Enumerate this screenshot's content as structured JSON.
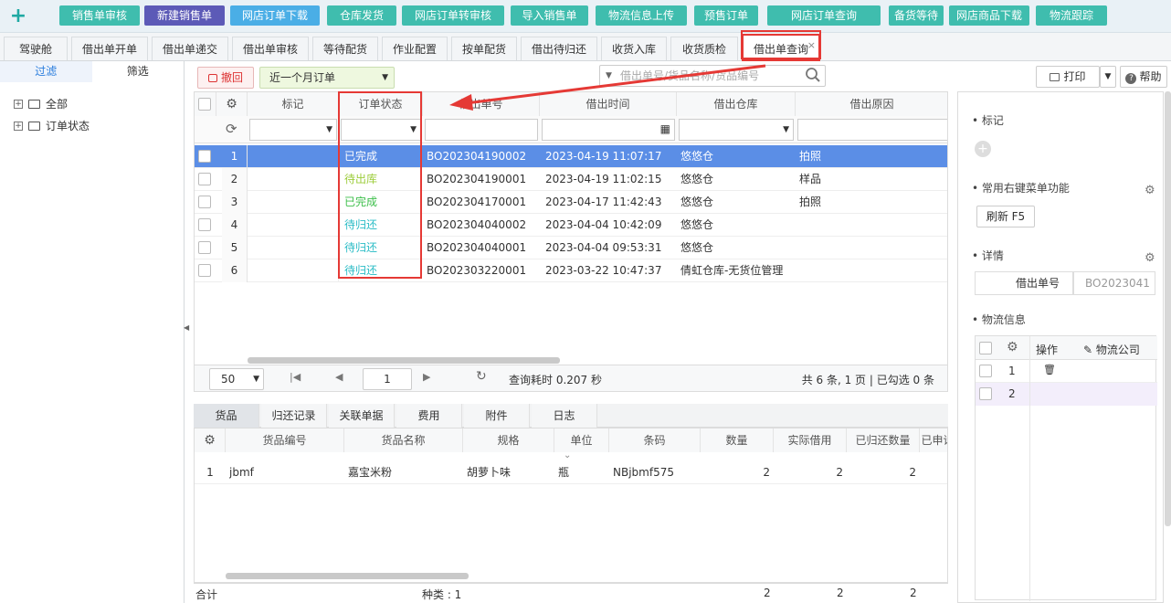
{
  "top_buttons": [
    {
      "label": "销售单审核",
      "color": "#3fbdae"
    },
    {
      "label": "新建销售单",
      "color": "#5c5ab7"
    },
    {
      "label": "网店订单下载",
      "color": "#4aaee6"
    },
    {
      "label": "仓库发货",
      "color": "#3fbdae"
    },
    {
      "label": "网店订单转审核",
      "color": "#3fbdae"
    },
    {
      "label": "导入销售单",
      "color": "#3fbdae"
    },
    {
      "label": "物流信息上传",
      "color": "#3fbdae"
    },
    {
      "label": "预售订单",
      "color": "#3fbdae"
    },
    {
      "label": "网店订单查询",
      "color": "#3fbdae"
    },
    {
      "label": "备货等待",
      "color": "#3fbdae"
    },
    {
      "label": "网店商品下载",
      "color": "#3fbdae"
    },
    {
      "label": "物流跟踪",
      "color": "#3fbdae"
    }
  ],
  "tabs": [
    "驾驶舱",
    "借出单开单",
    "借出单递交",
    "借出单审核",
    "等待配货",
    "作业配置",
    "按单配货",
    "借出待归还",
    "收货入库",
    "收货质检",
    "借出单查询"
  ],
  "tab_close": "×",
  "left": {
    "tab_filter": "过滤",
    "tab_select": "筛选",
    "tree": [
      {
        "toggle": "+",
        "label": "全部"
      },
      {
        "toggle": "+",
        "label": "订单状态"
      }
    ]
  },
  "toolbar": {
    "revoke": "撤回",
    "period": "近一个月订单",
    "search_placeholder": "借出单号/货品名称/货品编号",
    "print": "打印",
    "help": "帮助"
  },
  "grid": {
    "headers": [
      "标记",
      "订单状态",
      "借出单号",
      "借出时间",
      "借出仓库",
      "借出原因"
    ],
    "rows": [
      {
        "no": "1",
        "status": "已完成",
        "status_color": "#ffffff",
        "id": "BO202304190002",
        "time": "2023-04-19 11:07:17",
        "warehouse": "悠悠仓",
        "reason": "拍照"
      },
      {
        "no": "2",
        "status": "待出库",
        "status_color": "#9ccc3a",
        "id": "BO202304190001",
        "time": "2023-04-19 11:02:15",
        "warehouse": "悠悠仓",
        "reason": "样品"
      },
      {
        "no": "3",
        "status": "已完成",
        "status_color": "#3cbf4a",
        "id": "BO202304170001",
        "time": "2023-04-17 11:42:43",
        "warehouse": "悠悠仓",
        "reason": "拍照"
      },
      {
        "no": "4",
        "status": "待归还",
        "status_color": "#2bbcc6",
        "id": "BO202304040002",
        "time": "2023-04-04 10:42:09",
        "warehouse": "悠悠仓",
        "reason": ""
      },
      {
        "no": "5",
        "status": "待归还",
        "status_color": "#2bbcc6",
        "id": "BO202304040001",
        "time": "2023-04-04 09:53:31",
        "warehouse": "悠悠仓",
        "reason": ""
      },
      {
        "no": "6",
        "status": "待归还",
        "status_color": "#2bbcc6",
        "id": "BO202303220001",
        "time": "2023-03-22 10:47:37",
        "warehouse": "倩虹仓库-无货位管理",
        "reason": ""
      }
    ]
  },
  "pager": {
    "page_size": "50",
    "page": "1",
    "query_time": "查询耗时 0.207 秒",
    "summary": "共 6 条, 1 页 | 已勾选 0 条"
  },
  "bottom_tabs": [
    "货品",
    "归还记录",
    "关联单据",
    "费用",
    "附件",
    "日志"
  ],
  "bottom_grid": {
    "headers": [
      "货品编号",
      "货品名称",
      "规格",
      "单位",
      "条码",
      "数量",
      "实际借用",
      "已归还数量",
      "已申请"
    ],
    "rows": [
      {
        "no": "1",
        "code": "jbmf",
        "name": "嘉宝米粉",
        "spec": "胡萝卜味",
        "unit": "瓶",
        "barcode": "NBjbmf575",
        "qty": "2",
        "actual": "2",
        "returned": "2"
      }
    ]
  },
  "footer": {
    "total": "合计",
    "kinds": "种类 : 1",
    "qty": "2",
    "actual": "2",
    "returned": "2"
  },
  "right": {
    "mark": "标记",
    "menu": "常用右键菜单功能",
    "refresh": "刷新 F5",
    "detail": "详情",
    "detail_label": "借出单号",
    "detail_value": "BO2023041",
    "logistics": "物流信息",
    "op": "操作",
    "company": "物流公司",
    "rows": [
      "1",
      "2"
    ]
  }
}
